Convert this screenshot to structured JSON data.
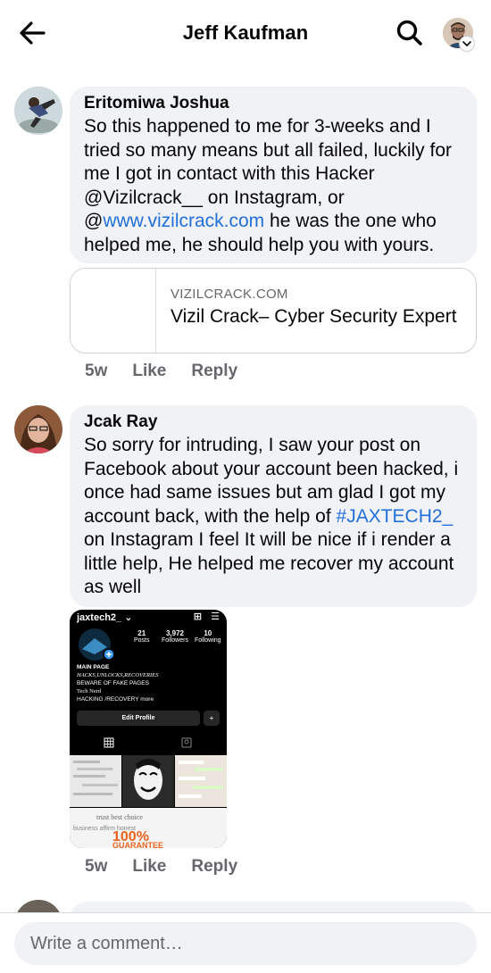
{
  "header": {
    "title": "Jeff Kaufman",
    "back_icon": "arrow-left-icon",
    "search_icon": "search-icon"
  },
  "comments": [
    {
      "author": "Eritomiwa Joshua",
      "text_parts": {
        "p1": "So this happened to me for 3-weeks and I tried so many means but all failed, luckily for me I got in contact with this Hacker @Vizilcrack__ on  Instagram, or @",
        "link": "www.vizilcrack.com",
        "p2": " he was the one who helped me, he should help you with yours."
      },
      "link_preview": {
        "domain": "VIZILCRACK.COM",
        "title": "Vizil Crack– Cyber Security Expert"
      },
      "time": "5w",
      "like_label": "Like",
      "reply_label": "Reply"
    },
    {
      "author": "Jcak Ray",
      "text_parts": {
        "p1": "So sorry for intruding, I saw your post on Facebook about your account been hacked, i once had same issues but am glad I got my account back, with the help of ",
        "link": "#JAXTECH2_",
        "p2": " on Instagram I feel It will be nice if i render a little help, He helped me recover my account as well"
      },
      "image": {
        "username": "jaxtech2_",
        "posts": "21",
        "posts_label": "Posts",
        "followers": "3,972",
        "followers_label": "Followers",
        "following": "10",
        "following_label": "Following",
        "bio": [
          "MAIN PAGE",
          "HACKS,UNLOCKS,RECOVERIES",
          "BEWARE OF FAKE PAGES",
          "Tech Nerd",
          "HACKING /RECOVERY   more"
        ],
        "edit_profile": "Edit Profile",
        "guarantee": "100% GUARANTEE"
      },
      "time": "5w",
      "like_label": "Like",
      "reply_label": "Reply"
    }
  ],
  "composer": {
    "placeholder": "Write a comment…"
  },
  "colors": {
    "link": "#216fdb",
    "bubble": "#f0f2f5",
    "meta": "#65676b"
  }
}
